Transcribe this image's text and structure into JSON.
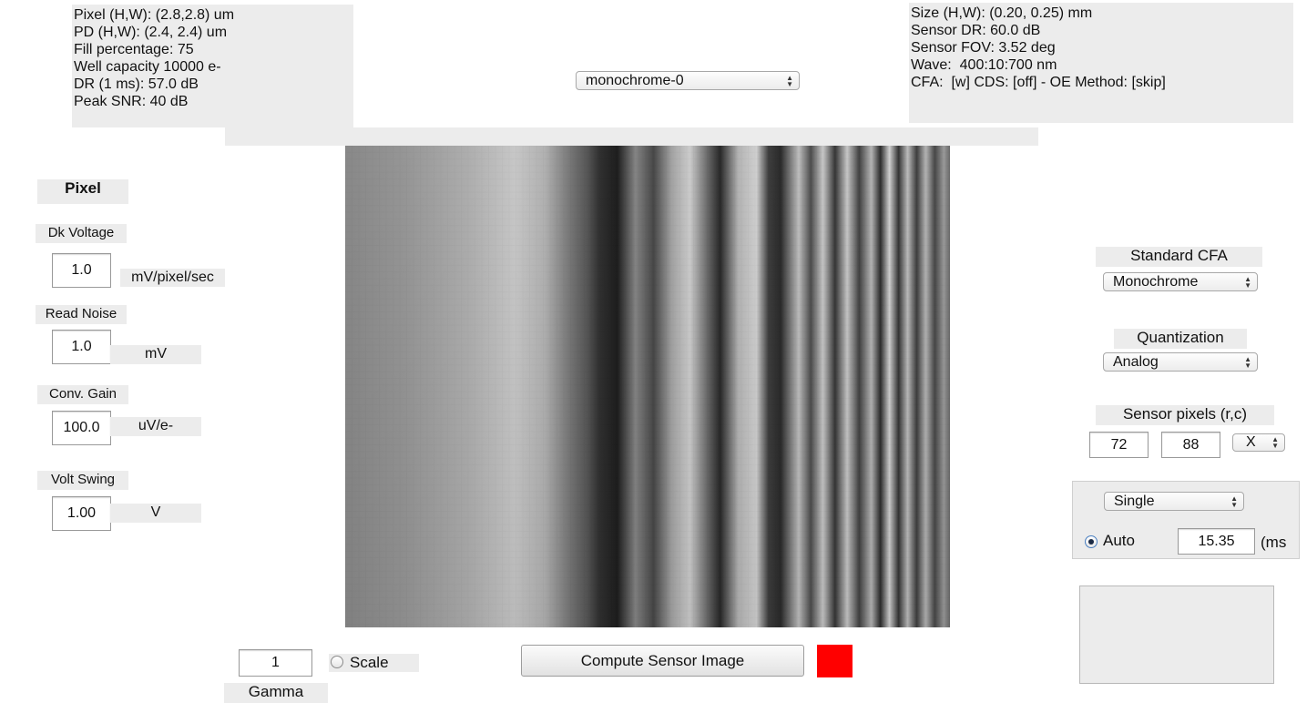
{
  "info_left": {
    "lines": [
      "Pixel (H,W): (2.8,2.8) um",
      "PD (H,W): (2.4, 2.4) um",
      "Fill percentage: 75",
      "Well capacity 10000 e-",
      "DR (1 ms): 57.0 dB",
      "Peak SNR: 40 dB"
    ]
  },
  "info_right": {
    "lines": [
      "Size (H,W): (0.20, 0.25) mm",
      "Sensor DR: 60.0 dB",
      "Sensor FOV: 3.52 deg",
      "Wave:  400:10:700 nm",
      "CFA:  [w] CDS: [off] - OE Method: [skip]"
    ]
  },
  "sensor_select": {
    "value": "monochrome-0"
  },
  "pixel_panel": {
    "title": "Pixel",
    "dk_voltage": {
      "label": "Dk Voltage",
      "value": "1.0",
      "unit": "mV/pixel/sec"
    },
    "read_noise": {
      "label": "Read Noise",
      "value": "1.0",
      "unit": "mV"
    },
    "conv_gain": {
      "label": "Conv. Gain",
      "value": "100.0",
      "unit": "uV/e-"
    },
    "volt_swing": {
      "label": "Volt Swing",
      "value": "1.00",
      "unit": "V"
    }
  },
  "right_panel": {
    "cfa_label": "Standard CFA",
    "cfa_value": "Monochrome",
    "quant_label": "Quantization",
    "quant_value": "Analog",
    "pixels_label": "Sensor pixels  (r,c)",
    "rows": "72",
    "cols": "88",
    "x_select": "X",
    "exposure_mode": "Single",
    "auto_label": "Auto",
    "auto_checked": true,
    "exposure_value": "15.35",
    "exposure_unit": "(ms"
  },
  "bottom": {
    "gamma_value": "1",
    "gamma_label": "Gamma",
    "scale_label": "Scale",
    "scale_checked": false,
    "compute_label": "Compute Sensor  Image",
    "status_color": "#ff0000"
  }
}
